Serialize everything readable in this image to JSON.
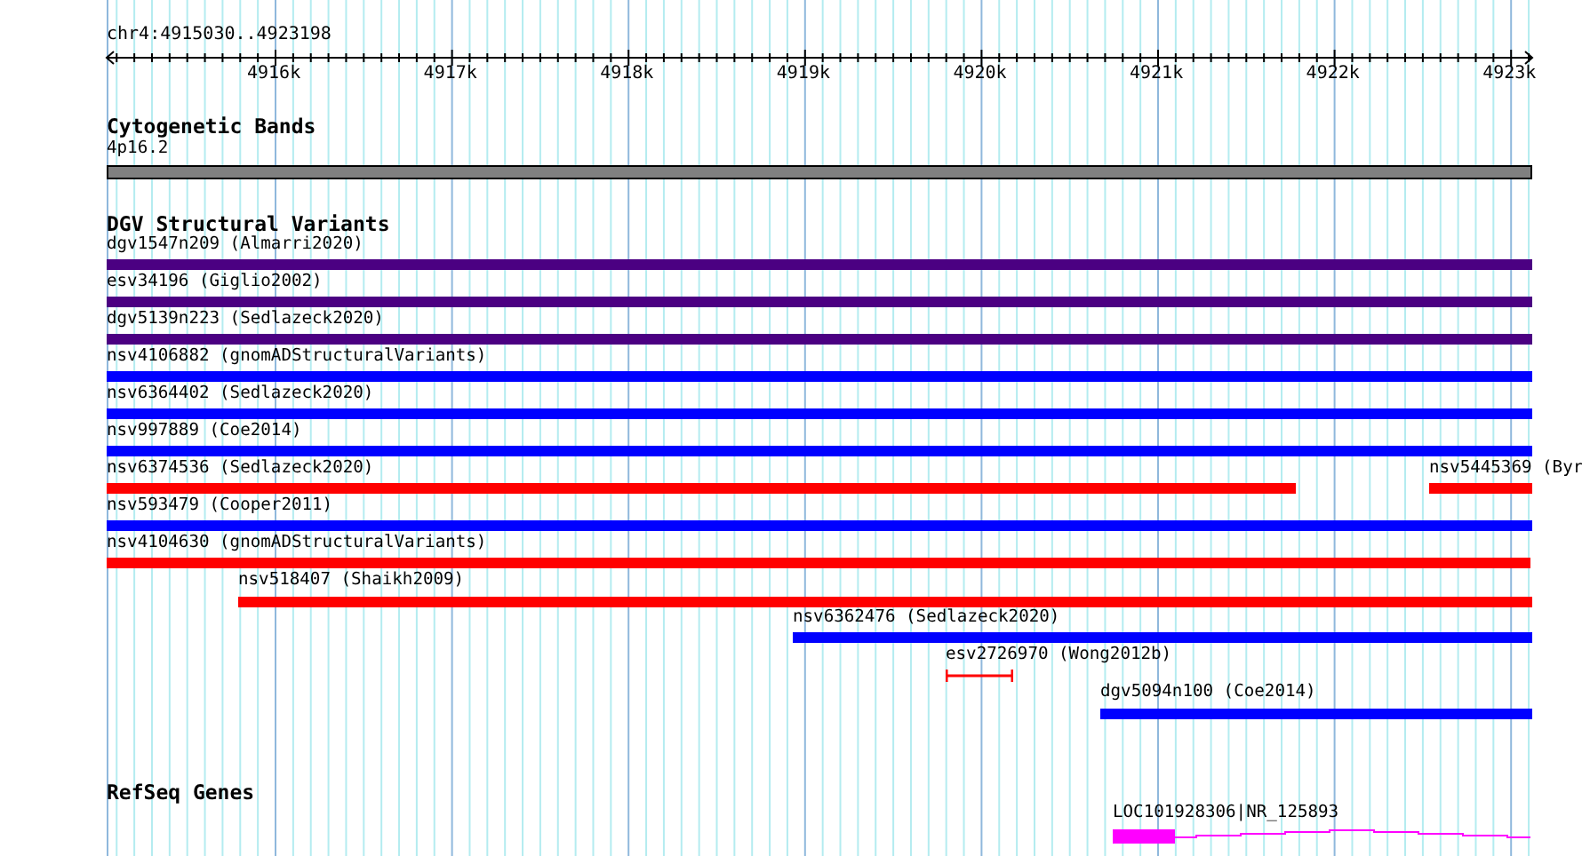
{
  "ruler": {
    "title": "chr4:4915030..4923198",
    "ticks": [
      "4916k",
      "4917k",
      "4918k",
      "4919k",
      "4920k",
      "4921k",
      "4922k",
      "4923k"
    ]
  },
  "tracks": [
    {
      "title": "Cytogenetic Bands",
      "features": [
        {
          "label": "4p16.2",
          "color": "#808080",
          "kind": "band"
        }
      ]
    },
    {
      "title": "DGV Structural Variants",
      "features": [
        {
          "label": "dgv1547n209 (Almarri2020)",
          "color": "#4b0082",
          "kind": "bar"
        },
        {
          "label": "esv34196 (Giglio2002)",
          "color": "#4b0082",
          "kind": "bar"
        },
        {
          "label": "dgv5139n223 (Sedlazeck2020)",
          "color": "#4b0082",
          "kind": "bar"
        },
        {
          "label": "nsv4106882 (gnomADStructuralVariants)",
          "color": "#0000ff",
          "kind": "bar"
        },
        {
          "label": "nsv6364402 (Sedlazeck2020)",
          "color": "#0000ff",
          "kind": "bar"
        },
        {
          "label": "nsv997889 (Coe2014)",
          "color": "#0000ff",
          "kind": "bar"
        },
        {
          "label": "nsv6374536 (Sedlazeck2020)",
          "color": "#ff0000",
          "kind": "bar"
        },
        {
          "label": "nsv5445369 (Byr",
          "color": "#ff0000",
          "kind": "bar"
        },
        {
          "label": "nsv593479 (Cooper2011)",
          "color": "#0000ff",
          "kind": "bar"
        },
        {
          "label": "nsv4104630 (gnomADStructuralVariants)",
          "color": "#ff0000",
          "kind": "bar"
        },
        {
          "label": "nsv518407 (Shaikh2009)",
          "color": "#ff0000",
          "kind": "bar"
        },
        {
          "label": "nsv6362476 (Sedlazeck2020)",
          "color": "#0000ff",
          "kind": "bar"
        },
        {
          "label": "esv2726970 (Wong2012b)",
          "color": "#ff0000",
          "kind": "interval"
        },
        {
          "label": "dgv5094n100 (Coe2014)",
          "color": "#0000ff",
          "kind": "bar"
        }
      ]
    },
    {
      "title": "RefSeq Genes",
      "features": [
        {
          "label": "LOC101928306|NR_125893",
          "color": "#ff00ff",
          "kind": "gene"
        }
      ]
    }
  ]
}
